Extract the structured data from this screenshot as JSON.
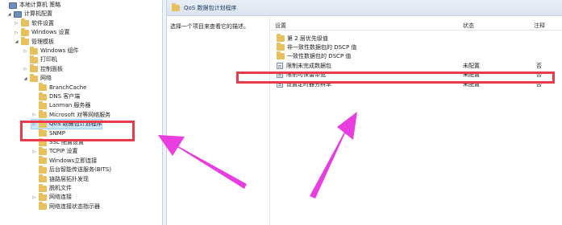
{
  "tree": {
    "items": [
      {
        "label": "本地计算机 策略",
        "icon": "computer-icon",
        "level": 0,
        "expander": "none"
      },
      {
        "label": "计算机配置",
        "icon": "computer-icon",
        "level": 1,
        "expander": "expanded"
      },
      {
        "label": "软件设置",
        "icon": "folder-icon",
        "level": 2,
        "expander": "collapsed"
      },
      {
        "label": "Windows 设置",
        "icon": "folder-icon",
        "level": 2,
        "expander": "collapsed"
      },
      {
        "label": "管理模板",
        "icon": "folder-icon",
        "level": 2,
        "expander": "expanded"
      },
      {
        "label": "Windows 组件",
        "icon": "folder-icon",
        "level": 3,
        "expander": "collapsed"
      },
      {
        "label": "打印机",
        "icon": "folder-icon",
        "level": 3,
        "expander": "none"
      },
      {
        "label": "控制面板",
        "icon": "folder-icon",
        "level": 3,
        "expander": "collapsed"
      },
      {
        "label": "网络",
        "icon": "folder-icon",
        "level": 3,
        "expander": "expanded"
      },
      {
        "label": "BranchCache",
        "icon": "folder-icon",
        "level": 4,
        "expander": "none"
      },
      {
        "label": "DNS 客户端",
        "icon": "folder-icon",
        "level": 4,
        "expander": "none"
      },
      {
        "label": "Lanman 服务器",
        "icon": "folder-icon",
        "level": 4,
        "expander": "none"
      },
      {
        "label": "Microsoft 对等网络服务",
        "icon": "folder-icon",
        "level": 4,
        "expander": "collapsed"
      },
      {
        "label": "QoS 数据包计划程序",
        "icon": "folder-icon",
        "level": 4,
        "expander": "collapsed",
        "selected": true
      },
      {
        "label": "SNMP",
        "icon": "folder-icon",
        "level": 4,
        "expander": "none"
      },
      {
        "label": "SSL 配置设置",
        "icon": "folder-icon",
        "level": 4,
        "expander": "none"
      },
      {
        "label": "TCPIP 设置",
        "icon": "folder-icon",
        "level": 4,
        "expander": "collapsed"
      },
      {
        "label": "Windows立即连接",
        "icon": "folder-icon",
        "level": 4,
        "expander": "none"
      },
      {
        "label": "后台智能传送服务(BITS)",
        "icon": "folder-icon",
        "level": 4,
        "expander": "none"
      },
      {
        "label": "链路层拓扑发现",
        "icon": "folder-icon",
        "level": 4,
        "expander": "none"
      },
      {
        "label": "脱机文件",
        "icon": "folder-icon",
        "level": 4,
        "expander": "none"
      },
      {
        "label": "网络连接",
        "icon": "folder-icon",
        "level": 4,
        "expander": "collapsed"
      },
      {
        "label": "网络连接状态指示器",
        "icon": "folder-icon",
        "level": 4,
        "expander": "none"
      }
    ]
  },
  "right": {
    "header_title": "QoS 数据包计划程序",
    "description": "选择一个项目来查看它的描述。",
    "columns": {
      "setting": "设置",
      "state": "状态",
      "note": "注释"
    },
    "rows": [
      {
        "name": "第 2 层优先级值",
        "icon": "folder-icon",
        "state": "",
        "note": ""
      },
      {
        "name": "非一致性数据包的 DSCP 值",
        "icon": "folder-icon",
        "state": "",
        "note": ""
      },
      {
        "name": "一致性数据包的 DSCP 值",
        "icon": "folder-icon",
        "state": "",
        "note": ""
      },
      {
        "name": "限制未完成数据包",
        "icon": "policy-setting-icon",
        "state": "未配置",
        "note": "否"
      },
      {
        "name": "限制可保留带宽",
        "icon": "policy-setting-icon",
        "state": "未配置",
        "note": "否",
        "highlighted": true
      },
      {
        "name": "设置定时器分辨率",
        "icon": "policy-setting-icon",
        "state": "未配置",
        "note": "否"
      }
    ]
  },
  "colors": {
    "highlight_red": "#ea3b4d",
    "arrow_pink": "#e83ee0",
    "selection_blue": "#cce8ff",
    "folder_yellow": "#e8c15c"
  }
}
